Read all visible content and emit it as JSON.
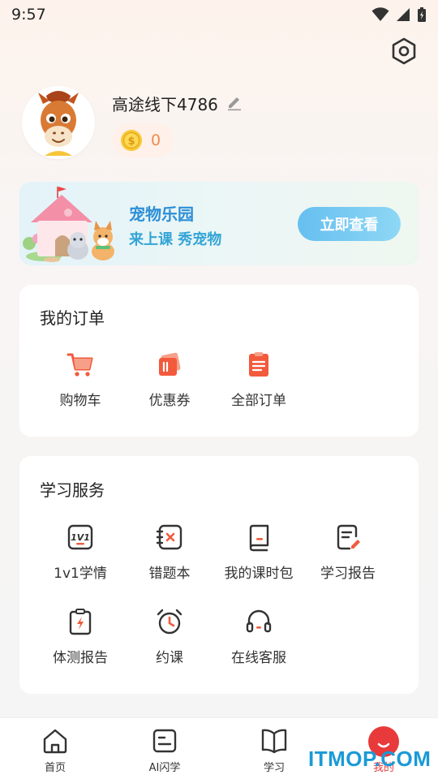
{
  "status_bar": {
    "time": "9:57"
  },
  "profile": {
    "name": "高途线下4786",
    "coins": "0"
  },
  "pet_banner": {
    "title": "宠物乐园",
    "subtitle": "来上课 秀宠物",
    "cta": "立即查看"
  },
  "orders": {
    "title": "我的订单",
    "items": [
      {
        "label": "购物车",
        "icon": "cart-icon"
      },
      {
        "label": "优惠券",
        "icon": "coupon-icon"
      },
      {
        "label": "全部订单",
        "icon": "orders-icon"
      }
    ]
  },
  "services": {
    "title": "学习服务",
    "items": [
      {
        "label": "1v1学情",
        "icon": "1v1-icon"
      },
      {
        "label": "错题本",
        "icon": "mistake-book-icon"
      },
      {
        "label": "我的课时包",
        "icon": "lesson-package-icon"
      },
      {
        "label": "学习报告",
        "icon": "study-report-icon"
      },
      {
        "label": "体测报告",
        "icon": "test-report-icon"
      },
      {
        "label": "约课",
        "icon": "alarm-clock-icon"
      },
      {
        "label": "在线客服",
        "icon": "headset-icon"
      }
    ]
  },
  "bottom_nav": {
    "items": [
      {
        "label": "首页",
        "icon": "home-icon"
      },
      {
        "label": "AI闪学",
        "icon": "ai-learn-icon"
      },
      {
        "label": "学习",
        "icon": "book-icon"
      },
      {
        "label": "我的",
        "icon": "me-icon"
      }
    ]
  },
  "watermark": "ITMOP.COM",
  "colors": {
    "accent_orange": "#f25a3c",
    "accent_blue": "#2c8fd7",
    "nav_active": "#e83a3a"
  }
}
